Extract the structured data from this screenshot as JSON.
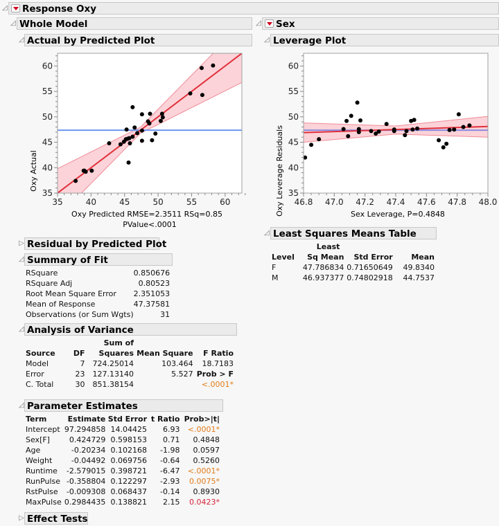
{
  "report": {
    "title": "Response Oxy",
    "whole_model": "Whole Model",
    "sex_section": "Sex"
  },
  "actual_by_predicted": {
    "title": "Actual by Predicted Plot",
    "xlabel_line1": "Oxy Predicted RMSE=2.3511 RSq=0.85",
    "xlabel_line2": "PValue<.0001",
    "ylabel": "Oxy Actual"
  },
  "leverage_plot": {
    "title": "Leverage Plot",
    "xlabel": "Sex Leverage, P=0.4848",
    "ylabel": "Oxy Leverage Residuals"
  },
  "chart_data": [
    {
      "type": "scatter",
      "name": "actual-by-predicted",
      "title": "Actual by Predicted Plot",
      "xlabel": "Oxy Predicted RMSE=2.3511 RSq=0.85 PValue<.0001",
      "ylabel": "Oxy Actual",
      "xlim": [
        35,
        62.5
      ],
      "ylim": [
        35,
        62.5
      ],
      "xticks": [
        35,
        40,
        45,
        50,
        55,
        60
      ],
      "yticks": [
        35,
        40,
        45,
        50,
        55,
        60
      ],
      "mean_line": 47.376,
      "fit_line": {
        "slope": 1,
        "intercept": 0
      },
      "confidence_band_halfwidth_at_ends": {
        "x35": 4.6,
        "x62_5": 5.5
      },
      "points": [
        [
          37.7,
          37.4
        ],
        [
          38.9,
          39.4
        ],
        [
          39.0,
          39.4
        ],
        [
          39.2,
          39.2
        ],
        [
          40.1,
          39.4
        ],
        [
          42.7,
          44.8
        ],
        [
          44.4,
          44.6
        ],
        [
          44.9,
          45.1
        ],
        [
          45.2,
          45.6
        ],
        [
          45.3,
          47.5
        ],
        [
          45.5,
          45.7
        ],
        [
          45.6,
          41.0
        ],
        [
          45.8,
          44.8
        ],
        [
          45.7,
          45.8
        ],
        [
          46.2,
          46.1
        ],
        [
          46.2,
          51.9
        ],
        [
          46.5,
          47.9
        ],
        [
          46.9,
          46.8
        ],
        [
          47.6,
          47.3
        ],
        [
          47.6,
          50.5
        ],
        [
          47.6,
          45.3
        ],
        [
          48.5,
          49.1
        ],
        [
          48.7,
          48.7
        ],
        [
          48.8,
          50.6
        ],
        [
          49.1,
          45.4
        ],
        [
          49.6,
          46.7
        ],
        [
          50.4,
          49.2
        ],
        [
          50.6,
          50.6
        ],
        [
          50.7,
          49.9
        ],
        [
          54.8,
          54.6
        ],
        [
          56.5,
          59.6
        ],
        [
          56.6,
          54.3
        ],
        [
          58.2,
          60.1
        ]
      ]
    },
    {
      "type": "scatter",
      "name": "sex-leverage",
      "title": "Leverage Plot",
      "xlabel": "Sex Leverage, P=0.4848",
      "ylabel": "Oxy Leverage Residuals",
      "xlim": [
        46.8,
        48.0
      ],
      "ylim": [
        35,
        62.5
      ],
      "xticks": [
        46.8,
        47.0,
        47.2,
        47.4,
        47.6,
        47.8,
        48.0
      ],
      "yticks": [
        35,
        40,
        45,
        50,
        55,
        60
      ],
      "mean_line": 47.376,
      "fit_line": {
        "x": [
          46.8,
          48.0
        ],
        "y": [
          46.9,
          48.1
        ]
      },
      "confidence_band": {
        "x": [
          46.8,
          47.4,
          48.0
        ],
        "lower": [
          45.0,
          46.6,
          46.0
        ],
        "upper": [
          48.8,
          48.2,
          50.1
        ]
      },
      "points": [
        [
          46.81,
          42.0
        ],
        [
          46.85,
          44.5
        ],
        [
          46.9,
          45.6
        ],
        [
          47.06,
          47.6
        ],
        [
          47.08,
          49.2
        ],
        [
          47.09,
          46.2
        ],
        [
          47.11,
          50.2
        ],
        [
          47.15,
          52.8
        ],
        [
          47.16,
          47.6
        ],
        [
          47.16,
          47.0
        ],
        [
          47.17,
          49.3
        ],
        [
          47.24,
          47.2
        ],
        [
          47.27,
          46.7
        ],
        [
          47.29,
          47.1
        ],
        [
          47.34,
          48.6
        ],
        [
          47.39,
          47.2
        ],
        [
          47.39,
          47.5
        ],
        [
          47.46,
          46.4
        ],
        [
          47.47,
          47.2
        ],
        [
          47.5,
          49.2
        ],
        [
          47.51,
          47.5
        ],
        [
          47.52,
          49.4
        ],
        [
          47.54,
          47.7
        ],
        [
          47.68,
          45.4
        ],
        [
          47.71,
          44.0
        ],
        [
          47.73,
          44.7
        ],
        [
          47.75,
          47.4
        ],
        [
          47.78,
          47.5
        ],
        [
          47.81,
          50.5
        ],
        [
          47.84,
          48.0
        ],
        [
          47.88,
          48.3
        ]
      ]
    }
  ],
  "residual_by_predicted": {
    "title": "Residual by Predicted Plot"
  },
  "summary_of_fit": {
    "title": "Summary of Fit",
    "rows": [
      {
        "label": "RSquare",
        "value": "0.850676"
      },
      {
        "label": "RSquare Adj",
        "value": "0.80523"
      },
      {
        "label": "Root Mean Square Error",
        "value": "2.351053"
      },
      {
        "label": "Mean of Response",
        "value": "47.37581"
      },
      {
        "label": "Observations (or Sum Wgts)",
        "value": "31"
      }
    ]
  },
  "anova": {
    "title": "Analysis of Variance",
    "headers": {
      "source": "Source",
      "df": "DF",
      "ss_top": "Sum of",
      "ss": "Squares",
      "ms": "Mean Square",
      "f": "F Ratio"
    },
    "rows": [
      {
        "source": "Model",
        "df": "7",
        "ss": "724.25014",
        "ms": "103.464",
        "f": "18.7183"
      },
      {
        "source": "Error",
        "df": "23",
        "ss": "127.13140",
        "ms": "5.527",
        "f": "Prob > F"
      },
      {
        "source": "C. Total",
        "df": "30",
        "ss": "851.38154",
        "ms": "",
        "f": "<.0001*"
      }
    ]
  },
  "parameter_estimates": {
    "title": "Parameter Estimates",
    "headers": {
      "term": "Term",
      "estimate": "Estimate",
      "se": "Std Error",
      "t": "t Ratio",
      "p": "Prob>|t|"
    },
    "rows": [
      {
        "term": "Intercept",
        "estimate": "97.294858",
        "se": "14.04425",
        "t": "6.93",
        "p": "<.0001*",
        "p_color": "orange"
      },
      {
        "term": "Sex[F]",
        "estimate": "0.424729",
        "se": "0.598153",
        "t": "0.71",
        "p": "0.4848",
        "p_color": ""
      },
      {
        "term": "Age",
        "estimate": "-0.20234",
        "se": "0.102168",
        "t": "-1.98",
        "p": "0.0597",
        "p_color": ""
      },
      {
        "term": "Weight",
        "estimate": "-0.04492",
        "se": "0.069756",
        "t": "-0.64",
        "p": "0.5260",
        "p_color": ""
      },
      {
        "term": "Runtime",
        "estimate": "-2.579015",
        "se": "0.398721",
        "t": "-6.47",
        "p": "<.0001*",
        "p_color": "orange"
      },
      {
        "term": "RunPulse",
        "estimate": "-0.358804",
        "se": "0.122297",
        "t": "-2.93",
        "p": "0.0075*",
        "p_color": "orange"
      },
      {
        "term": "RstPulse",
        "estimate": "-0.009308",
        "se": "0.068437",
        "t": "-0.14",
        "p": "0.8930",
        "p_color": ""
      },
      {
        "term": "MaxPulse",
        "estimate": "0.2984435",
        "se": "0.138821",
        "t": "2.15",
        "p": "0.0423*",
        "p_color": "red"
      }
    ]
  },
  "effect_tests": {
    "title": "Effect Tests"
  },
  "lsmeans": {
    "title": "Least Squares Means Table",
    "headers": {
      "level": "Level",
      "lsm_top": "Least",
      "lsm": "Sq Mean",
      "se": "Std Error",
      "mean": "Mean"
    },
    "rows": [
      {
        "level": "F",
        "lsm": "47.786834",
        "se": "0.71650649",
        "mean": "49.8340"
      },
      {
        "level": "M",
        "lsm": "46.937377",
        "se": "0.74802918",
        "mean": "44.7537"
      }
    ]
  },
  "colors": {
    "fit_line": "#e0303c",
    "band_fill": "#fbd3d8",
    "band_edge": "#f08c98",
    "mean_line": "#6a96f0",
    "mean_line_lev": "#8a8ce0",
    "significant_orange": "#e07b1a",
    "significant_red": "#d6243c"
  }
}
